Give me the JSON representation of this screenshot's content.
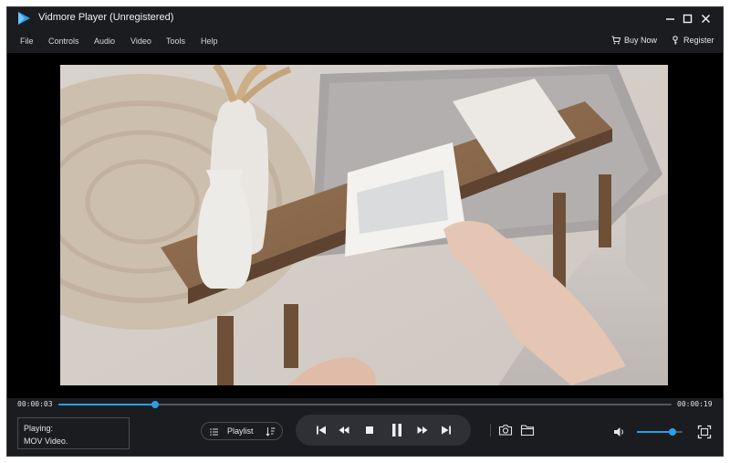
{
  "app": {
    "title": "Vidmore Player (Unregistered)",
    "accent_color": "#2a9fe8"
  },
  "window_controls": {
    "icons": [
      "minimize-icon",
      "maximize-icon",
      "close-icon"
    ]
  },
  "menu": {
    "items": [
      "File",
      "Controls",
      "Audio",
      "Video",
      "Tools",
      "Help"
    ],
    "buy_now": "Buy Now",
    "register": "Register"
  },
  "playback": {
    "current_time": "00:00:03",
    "total_time": "00:00:19",
    "progress_fraction": 0.158
  },
  "status": {
    "line1": "Playing:",
    "line2": "MOV Video."
  },
  "playlist": {
    "label": "Playlist"
  },
  "transport_icons": [
    "skip-previous-icon",
    "rewind-icon",
    "stop-icon",
    "pause-icon",
    "fast-forward-icon",
    "skip-next-icon"
  ],
  "tools": {
    "icons": [
      "camera-icon",
      "folder-icon"
    ]
  },
  "volume": {
    "level_fraction": 0.78
  }
}
